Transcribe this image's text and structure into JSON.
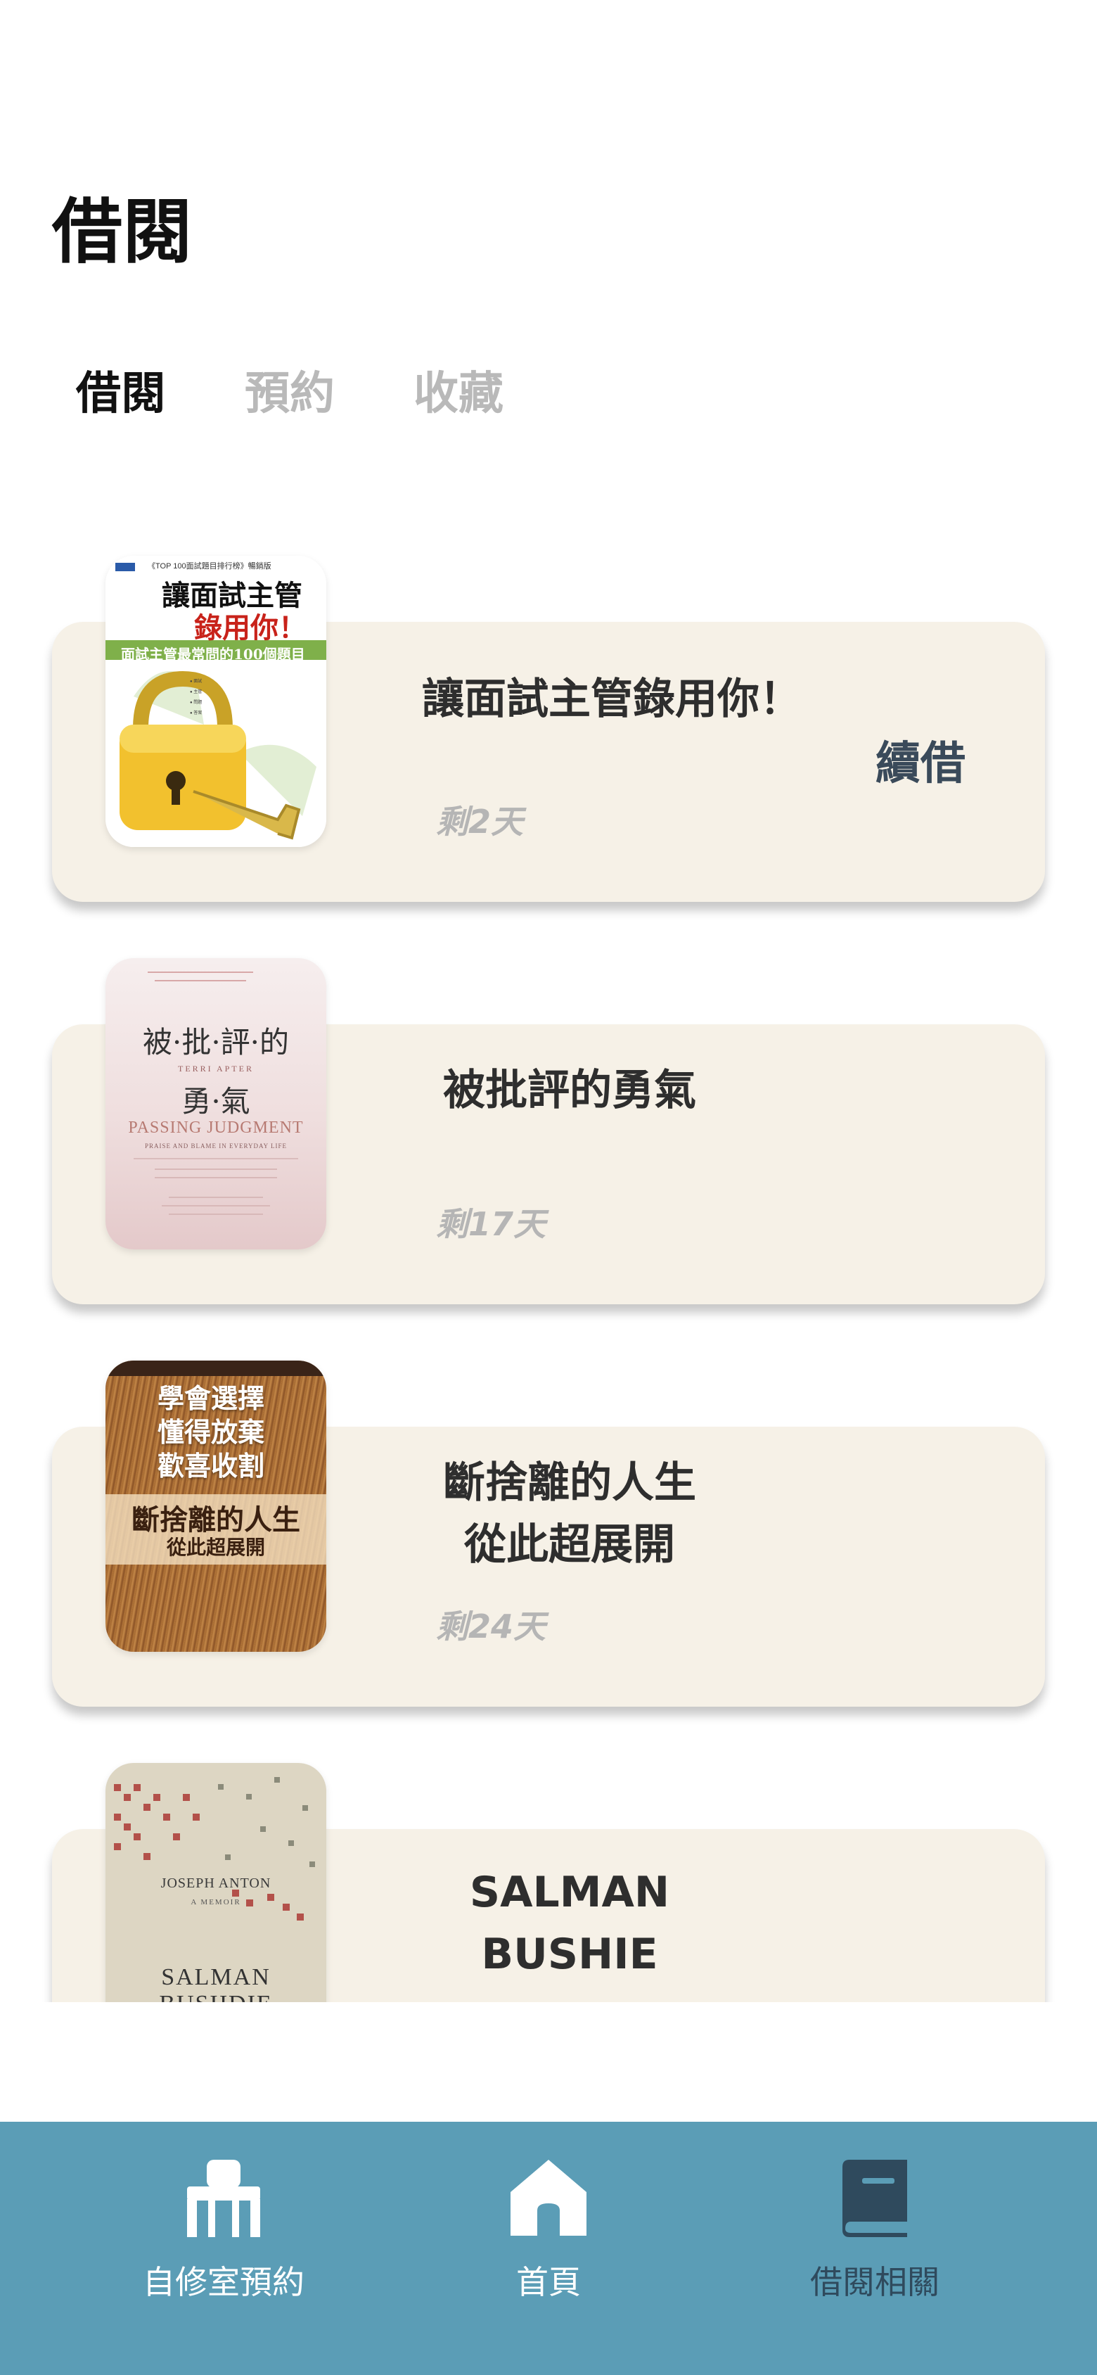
{
  "page": {
    "title": "借閱"
  },
  "tabs": [
    {
      "label": "借閱",
      "active": true
    },
    {
      "label": "預約",
      "active": false
    },
    {
      "label": "收藏",
      "active": false
    }
  ],
  "books": [
    {
      "title": "讓面試主管錄用你！",
      "remaining": "剩2天",
      "action": "續借",
      "cover": {
        "top_line": "《TOP 100面試題目排行榜》暢銷版",
        "title1": "讓面試主管",
        "title2": "錄用你！",
        "band": "面試主管最常問的100個題目"
      }
    },
    {
      "title": "被批評的勇氣",
      "remaining": "剩17天",
      "cover": {
        "line1": "被·批·評·的",
        "line2": "勇·氣",
        "author": "TERRI APTER",
        "en_title": "PASSING JUDGMENT",
        "en_sub": "PRAISE AND BLAME IN EVERYDAY LIFE"
      }
    },
    {
      "title": "斷捨離的人生\n從此超展開",
      "remaining": "剩24天",
      "cover": {
        "l1": "學會選擇",
        "l2": "懂得放棄",
        "l3": "歡喜收割",
        "main": "斷捨離的人生",
        "sub": "從此超展開"
      }
    },
    {
      "title": "SALMAN\nBUSHIE",
      "remaining": "",
      "cover": {
        "t1": "JOSEPH ANTON",
        "t2": "A MEMOIR",
        "t3": "SALMAN",
        "t4": "BUSHDIE"
      }
    }
  ],
  "nav": [
    {
      "label": "自修室預約",
      "icon": "desk-chair-icon",
      "active": false
    },
    {
      "label": "首頁",
      "icon": "home-icon",
      "active": false
    },
    {
      "label": "借閱相關",
      "icon": "book-icon",
      "active": true
    }
  ],
  "colors": {
    "nav_bg": "#5b9db6",
    "card_bg": "#f6f1e7",
    "active_nav": "#2f4a5d"
  }
}
